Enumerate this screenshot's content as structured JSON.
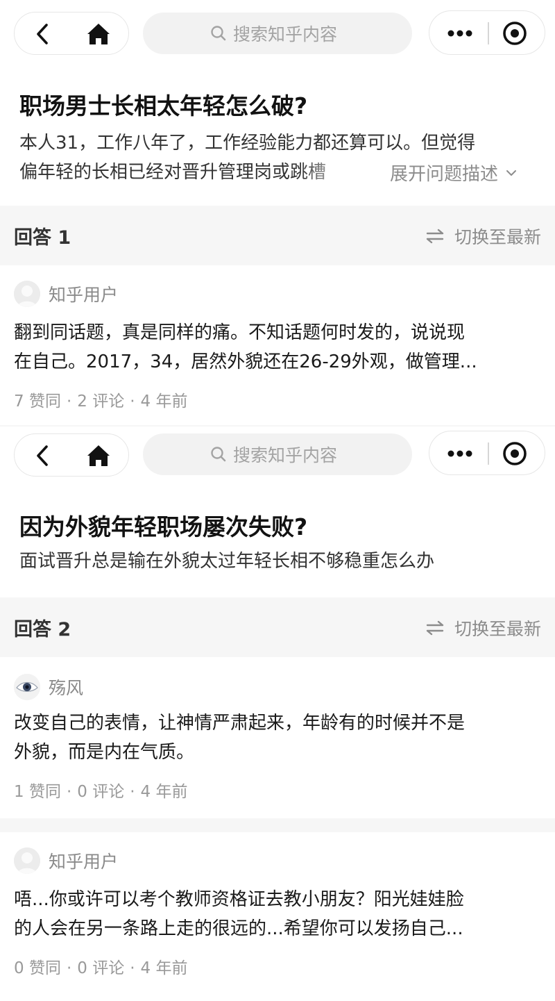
{
  "shot1": {
    "nav": {
      "search_placeholder": "搜索知乎内容",
      "icons": [
        "back-icon",
        "home-icon",
        "search-icon",
        "more-icon",
        "target-icon"
      ]
    },
    "question": {
      "title": "职场男士长相太年轻怎么破?",
      "desc_line1": "本人31，工作八年了，工作经验能力都还算可以。但觉得",
      "desc_line2": "偏年轻的长相已经对晋升管理岗或跳槽",
      "expand_label": "展开问题描述"
    },
    "answers_header": {
      "count_label": "回答 1",
      "switch_label": "切换至最新"
    },
    "answers": [
      {
        "author": "知乎用户",
        "line1": "翻到同话题，真是同样的痛。不知话题何时发的，说说现",
        "line2": "在自己。2017，34，居然外貌还在26-29外观，做管理...",
        "likes": "7 赞同",
        "comments": "2 评论",
        "time": "4 年前"
      }
    ]
  },
  "shot2": {
    "nav": {
      "search_placeholder": "搜索知乎内容"
    },
    "question": {
      "title": "因为外貌年轻职场屡次失败?",
      "desc_line1": "面试晋升总是输在外貌太过年轻长相不够稳重怎么办"
    },
    "answers_header": {
      "count_label": "回答 2",
      "switch_label": "切换至最新"
    },
    "answers": [
      {
        "author": "殇风",
        "line1": "改变自己的表情，让神情严肃起来，年龄有的时候并不是",
        "line2": "外貌，而是内在气质。",
        "likes": "1 赞同",
        "comments": "0 评论",
        "time": "4 年前"
      },
      {
        "author": "知乎用户",
        "line1": "唔...你或许可以考个教师资格证去教小朋友？阳光娃娃脸",
        "line2": "的人会在另一条路上走的很远的...希望你可以发扬自己...",
        "likes": "0 赞同",
        "comments": "0 评论",
        "time": "4 年前"
      }
    ]
  }
}
